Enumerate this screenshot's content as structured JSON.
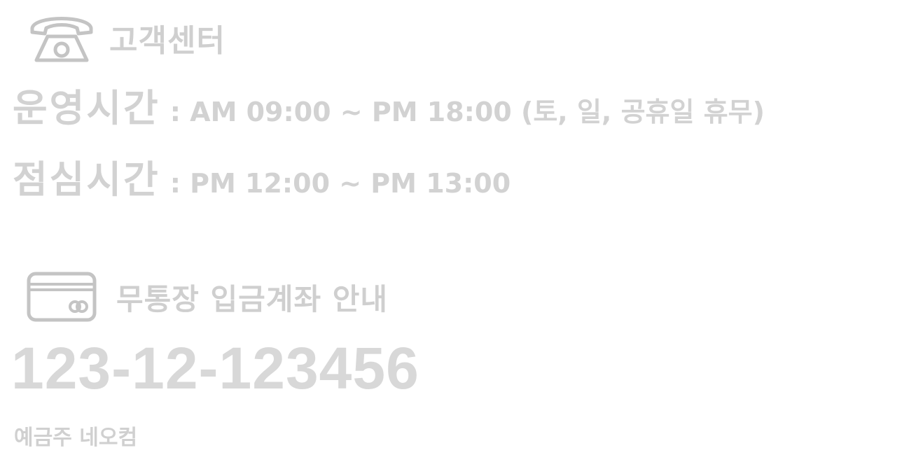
{
  "customer_center": {
    "icon": "telephone-icon",
    "title": "고객센터",
    "operating_hours": {
      "label": "운영시간",
      "value": ": AM 09:00 ~ PM 18:00 (토, 일, 공휴일 휴무)"
    },
    "lunch_hours": {
      "label": "점심시간",
      "value": ": PM 12:00 ~ PM 13:00"
    }
  },
  "bank_transfer": {
    "icon": "credit-card-icon",
    "title": "무통장 입금계좌 안내",
    "account_number": "123-12-123456",
    "account_holder": "예금주 네오컴"
  },
  "colors": {
    "text": "#d0d0d0",
    "icon_stroke": "#bdbdbd",
    "background": "#ffffff"
  }
}
